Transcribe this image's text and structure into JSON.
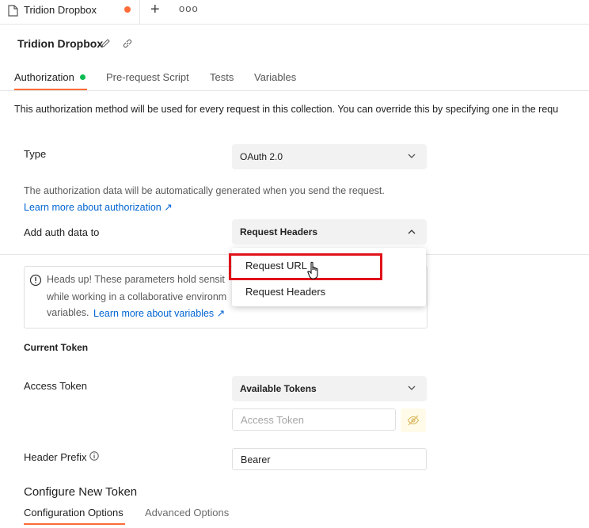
{
  "window_tab": {
    "title": "Tridion Dropbox"
  },
  "header": {
    "title": "Tridion Dropbox"
  },
  "tabs": [
    {
      "label": "Authorization"
    },
    {
      "label": "Pre-request Script"
    },
    {
      "label": "Tests"
    },
    {
      "label": "Variables"
    }
  ],
  "description": "This authorization method will be used for every request in this collection. You can override this by specifying one in the requ",
  "auth": {
    "type_label": "Type",
    "type_value": "OAuth 2.0",
    "info_text": "The authorization data will be automatically generated when you send the request.",
    "learn_more": "Learn more about authorization ↗",
    "add_to_label": "Add auth data to",
    "add_to_value": "Request Headers",
    "dropdown_options": [
      "Request URL",
      "Request Headers"
    ]
  },
  "warning": {
    "line1": "Heads up! These parameters hold sensit",
    "line2": "while working in a collaborative environm",
    "line3": "variables.",
    "link": "Learn more about variables ↗"
  },
  "current_token": {
    "heading": "Current Token",
    "access_token_label": "Access Token",
    "available_tokens": "Available Tokens",
    "access_token_placeholder": "Access Token",
    "header_prefix_label": "Header Prefix",
    "header_prefix_value": "Bearer"
  },
  "configure": {
    "heading": "Configure New Token",
    "tabs": [
      "Configuration Options",
      "Advanced Options"
    ]
  },
  "colors": {
    "accent": "#ff6c37",
    "active_dot": "#0cbb52",
    "link": "#0265d2",
    "highlight": "#e0121a"
  }
}
